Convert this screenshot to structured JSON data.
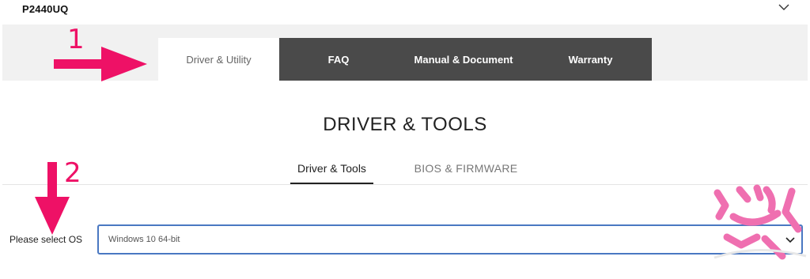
{
  "product": {
    "name": "P2440UQ",
    "toggle_icon": "chevron-down-icon"
  },
  "tabs": [
    {
      "label": "Driver & Utility",
      "active": true
    },
    {
      "label": "FAQ",
      "active": false
    },
    {
      "label": "Manual & Document",
      "active": false
    },
    {
      "label": "Warranty",
      "active": false
    }
  ],
  "section": {
    "title": "DRIVER & TOOLS"
  },
  "subtabs": [
    {
      "label": "Driver & Tools",
      "active": true
    },
    {
      "label": "BIOS & FIRMWARE",
      "active": false
    }
  ],
  "os_select": {
    "label": "Please select OS",
    "value": "Windows 10 64-bit",
    "dropdown_icon": "chevron-down-icon"
  },
  "annotations": {
    "step1": "1",
    "step2": "2",
    "color": "#ee1166"
  },
  "colors": {
    "tab_dark": "#4a4a4a",
    "tab_strip": "#f1f1f1",
    "select_border": "#4a78c2",
    "watermark": "#ef6fb0"
  }
}
